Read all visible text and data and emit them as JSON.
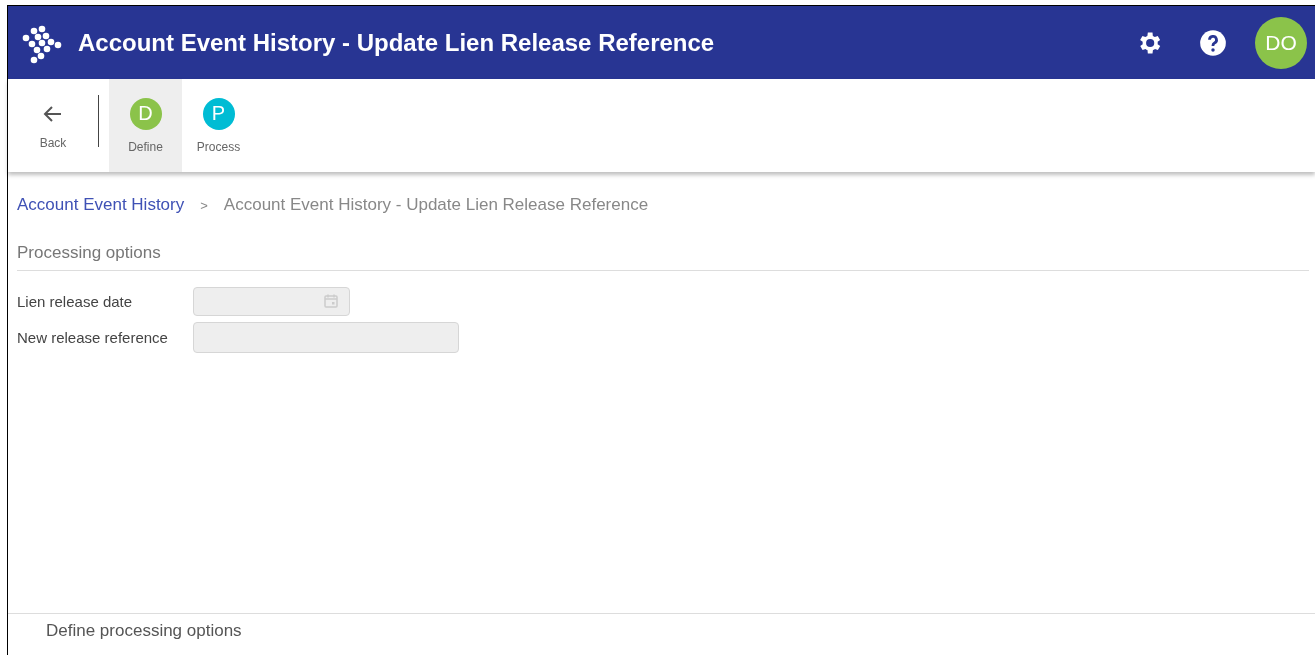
{
  "header": {
    "title": "Account Event History - Update Lien Release Reference",
    "avatar": "DO"
  },
  "toolbar": {
    "back": "Back",
    "steps": [
      {
        "letter": "D",
        "label": "Define",
        "color": "#8bc34a",
        "selected": true
      },
      {
        "letter": "P",
        "label": "Process",
        "color": "#00bcd4",
        "selected": false
      }
    ]
  },
  "breadcrumb": [
    {
      "label": "Account Event History",
      "kind": "link"
    },
    {
      "label": ">",
      "kind": "separator"
    },
    {
      "label": "Account Event History - Update Lien Release Reference",
      "kind": "current"
    }
  ],
  "section": {
    "title": "Processing options",
    "fields": [
      {
        "label": "Lien release date",
        "kind": "date",
        "disabled": true
      },
      {
        "label": "New release reference",
        "kind": "text",
        "disabled": true
      }
    ]
  },
  "footer": {
    "text": "Define processing options"
  }
}
